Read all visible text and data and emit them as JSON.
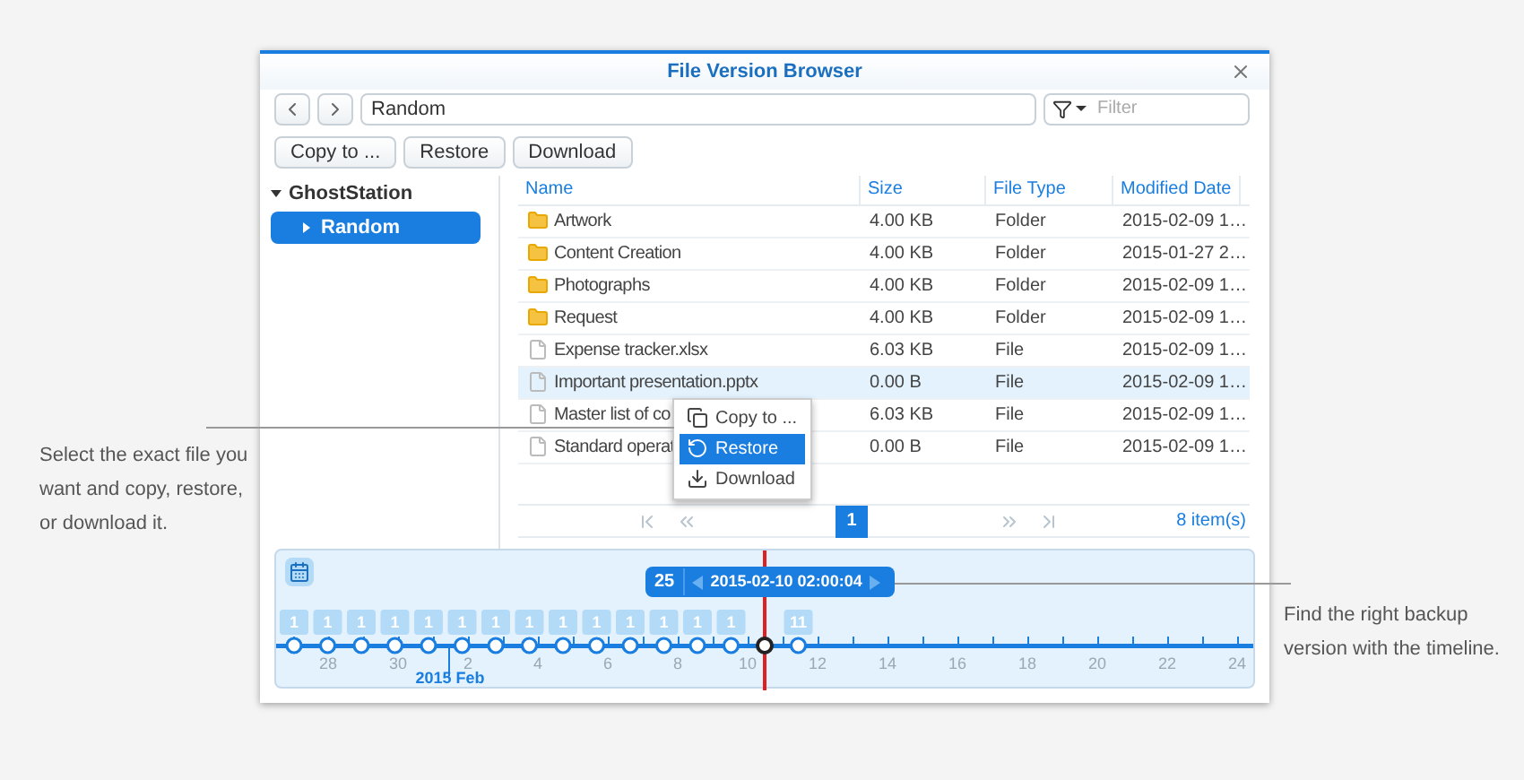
{
  "captions": {
    "left": "Select the exact file you want and copy, restore, or download it.",
    "right": "Find the right backup version with the timeline."
  },
  "window": {
    "title": "File Version Browser"
  },
  "toolbar": {
    "path": "Random",
    "filter_placeholder": "Filter",
    "buttons": [
      "Copy to ...",
      "Restore",
      "Download"
    ]
  },
  "sidebar": {
    "label": "GhostStation",
    "expanded": true,
    "children": [
      {
        "label": "Random",
        "selected": true,
        "expanded": false
      }
    ]
  },
  "table": {
    "columns": [
      "Name",
      "Size",
      "File Type",
      "Modified Date"
    ],
    "rows": [
      {
        "kind": "folder",
        "name": "Artwork",
        "size": "4.00 KB",
        "type": "Folder",
        "modified": "2015-02-09 1…",
        "selected": false
      },
      {
        "kind": "folder",
        "name": "Content Creation",
        "size": "4.00 KB",
        "type": "Folder",
        "modified": "2015-01-27 2…",
        "selected": false
      },
      {
        "kind": "folder",
        "name": "Photographs",
        "size": "4.00 KB",
        "type": "Folder",
        "modified": "2015-02-09 1…",
        "selected": false
      },
      {
        "kind": "folder",
        "name": "Request",
        "size": "4.00 KB",
        "type": "Folder",
        "modified": "2015-02-09 1…",
        "selected": false
      },
      {
        "kind": "file",
        "name": "Expense tracker.xlsx",
        "size": "6.03 KB",
        "type": "File",
        "modified": "2015-02-09 1…",
        "selected": false
      },
      {
        "kind": "file",
        "name": "Important presentation.pptx",
        "size": "0.00 B",
        "type": "File",
        "modified": "2015-02-09 1…",
        "selected": true
      },
      {
        "kind": "file",
        "name": "Master list of co",
        "size": "6.03 KB",
        "type": "File",
        "modified": "2015-02-09 1…",
        "selected": false
      },
      {
        "kind": "file",
        "name": "Standard operat",
        "size": "0.00 B",
        "type": "File",
        "modified": "2015-02-09 1…",
        "selected": false
      }
    ]
  },
  "context_menu": [
    {
      "kind": "copy",
      "label": "Copy to ...",
      "selected": false
    },
    {
      "kind": "restore",
      "label": "Restore",
      "selected": true
    },
    {
      "kind": "download",
      "label": "Download",
      "selected": false
    }
  ],
  "pagination": {
    "pages": [
      {
        "label": "1",
        "selected": true
      }
    ],
    "count": "8 item(s)"
  },
  "timeline": {
    "current": {
      "count": "25",
      "datetime": "2015-02-10 02:00:04"
    },
    "versions": [
      {
        "count": "1",
        "selected": false
      },
      {
        "count": "1",
        "selected": false
      },
      {
        "count": "1",
        "selected": false
      },
      {
        "count": "1",
        "selected": false
      },
      {
        "count": "1",
        "selected": false
      },
      {
        "count": "1",
        "selected": false
      },
      {
        "count": "1",
        "selected": false
      },
      {
        "count": "1",
        "selected": false
      },
      {
        "count": "1",
        "selected": false
      },
      {
        "count": "1",
        "selected": false
      },
      {
        "count": "1",
        "selected": false
      },
      {
        "count": "1",
        "selected": false
      },
      {
        "count": "1",
        "selected": false
      },
      {
        "count": "1",
        "selected": false
      },
      {
        "selected": true
      },
      {
        "count": "11",
        "selected": false
      }
    ],
    "day_labels": [
      "28",
      "30",
      "2",
      "4",
      "6",
      "8",
      "10",
      "12",
      "14",
      "16",
      "18",
      "20",
      "22",
      "24"
    ],
    "month_label": "2015 Feb"
  }
}
